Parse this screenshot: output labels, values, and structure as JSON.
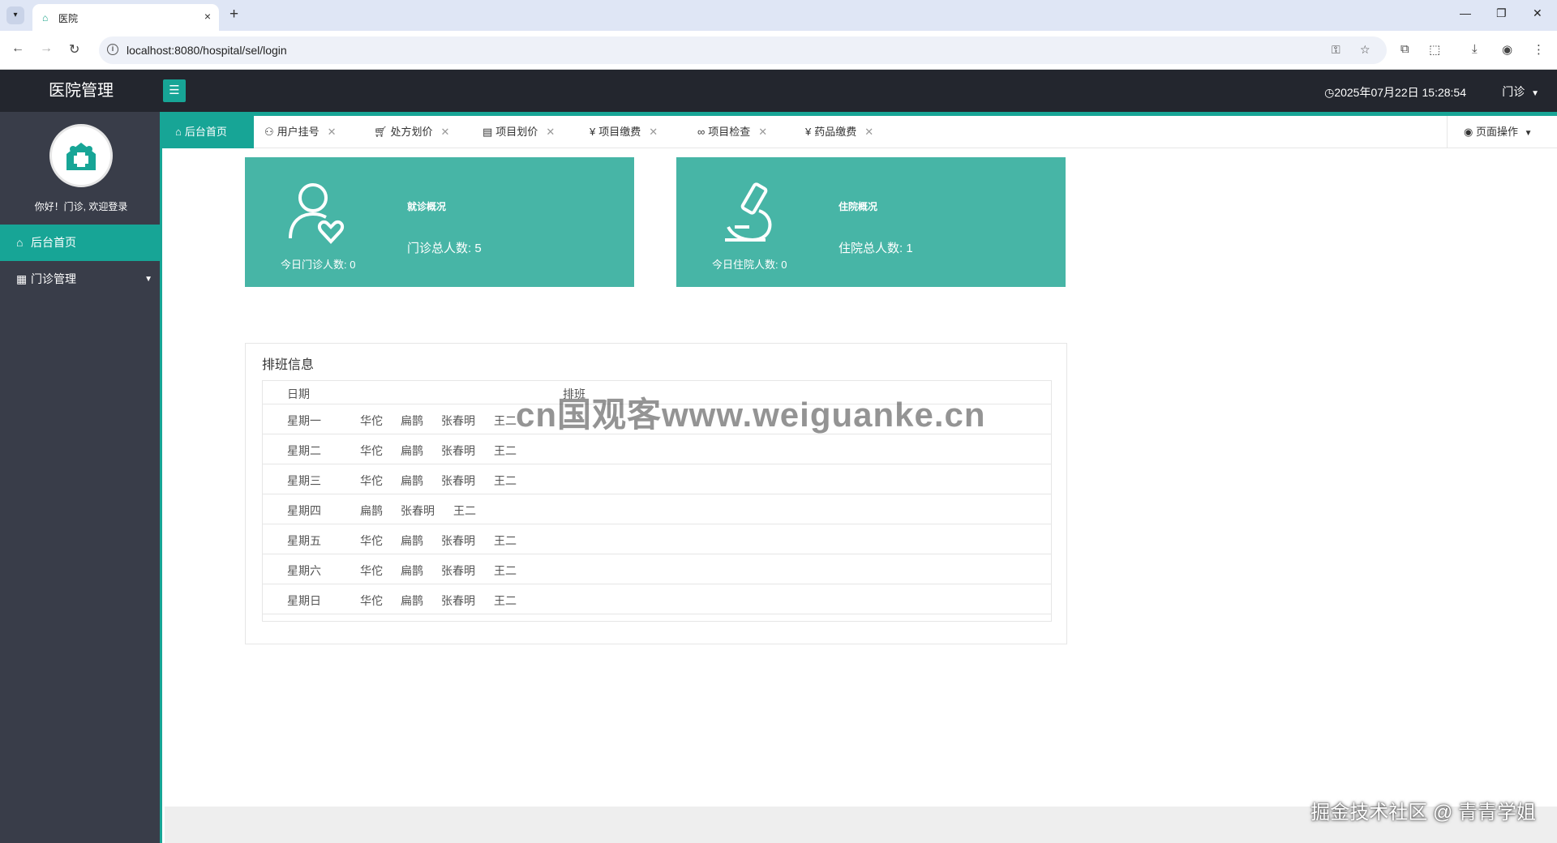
{
  "browser": {
    "tab_title": "医院",
    "url": "localhost:8080/hospital/sel/login"
  },
  "header": {
    "app_title": "医院管理",
    "datetime": "2025年07月22日 15:28:54",
    "user_menu": "门诊"
  },
  "sidebar": {
    "greeting": "你好！门诊, 欢迎登录",
    "items": [
      {
        "label": "后台首页"
      },
      {
        "label": "门诊管理"
      }
    ]
  },
  "tabs": [
    {
      "label": "后台首页"
    },
    {
      "label": "用户挂号"
    },
    {
      "label": "处方划价"
    },
    {
      "label": "项目划价"
    },
    {
      "label": "项目缴费"
    },
    {
      "label": "项目检查"
    },
    {
      "label": "药品缴费"
    }
  ],
  "page_ops": "页面操作",
  "cards": {
    "clinic": {
      "title": "就诊概况",
      "total": "门诊总人数: 5",
      "today": "今日门诊人数: 0"
    },
    "inpatient": {
      "title": "住院概况",
      "total": "住院总人数: 1",
      "today": "今日住院人数: 0"
    }
  },
  "schedule": {
    "title": "排班信息",
    "columns": [
      "日期",
      "排班"
    ],
    "rows": [
      {
        "day": "星期一",
        "doctors": [
          "华佗",
          "扁鹊",
          "张春明",
          "王二"
        ]
      },
      {
        "day": "星期二",
        "doctors": [
          "华佗",
          "扁鹊",
          "张春明",
          "王二"
        ]
      },
      {
        "day": "星期三",
        "doctors": [
          "华佗",
          "扁鹊",
          "张春明",
          "王二"
        ]
      },
      {
        "day": "星期四",
        "doctors": [
          "扁鹊",
          "张春明",
          "王二"
        ]
      },
      {
        "day": "星期五",
        "doctors": [
          "华佗",
          "扁鹊",
          "张春明",
          "王二"
        ]
      },
      {
        "day": "星期六",
        "doctors": [
          "华佗",
          "扁鹊",
          "张春明",
          "王二"
        ]
      },
      {
        "day": "星期日",
        "doctors": [
          "华佗",
          "扁鹊",
          "张春明",
          "王二"
        ]
      }
    ]
  },
  "overlays": {
    "watermark": "cn国观客www.weiguanke.cn",
    "credit": "掘金技术社区 @ 青青学姐"
  },
  "colors": {
    "accent": "#17a596",
    "card": "#47b5a6",
    "header": "#23262e",
    "sidebar": "#393d49"
  }
}
